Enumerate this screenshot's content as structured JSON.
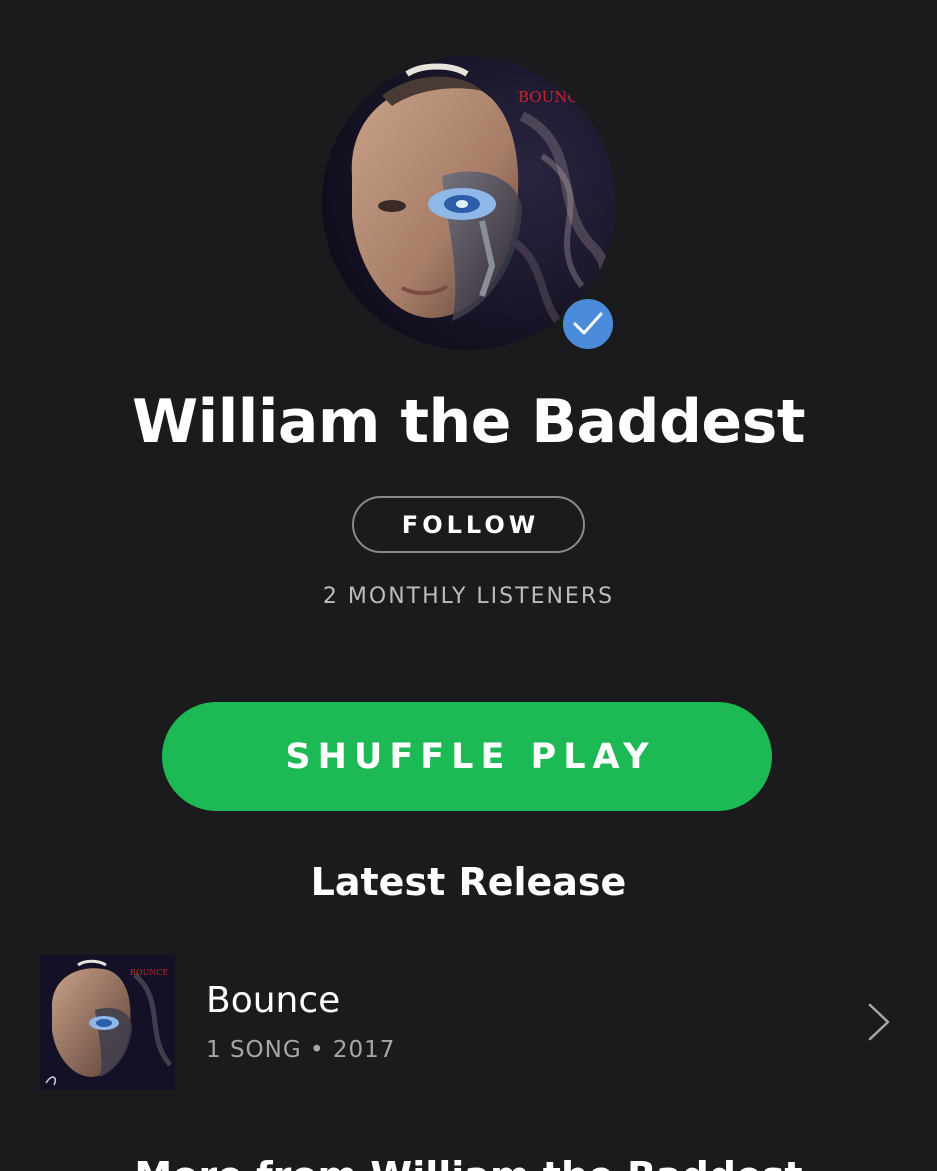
{
  "artist": {
    "name": "William the Baddest",
    "verified": true,
    "avatar_text": "BOUNCE",
    "follow_label": "FOLLOW",
    "monthly_listeners": "2 MONTHLY LISTENERS"
  },
  "actions": {
    "shuffle_label": "SHUFFLE PLAY"
  },
  "latest_release": {
    "section_title": "Latest Release",
    "title": "Bounce",
    "meta": "1 SONG • 2017",
    "cover_text": "BOUNCE"
  },
  "more_section": {
    "title": "More from William the Baddest"
  },
  "colors": {
    "background": "#1b1a1c",
    "accent_green": "#1db954",
    "verified_blue": "#4a8cd9",
    "secondary_text": "#bdbcbd"
  },
  "icons": {
    "verified": "check-icon",
    "chevron": "chevron-right-icon"
  }
}
